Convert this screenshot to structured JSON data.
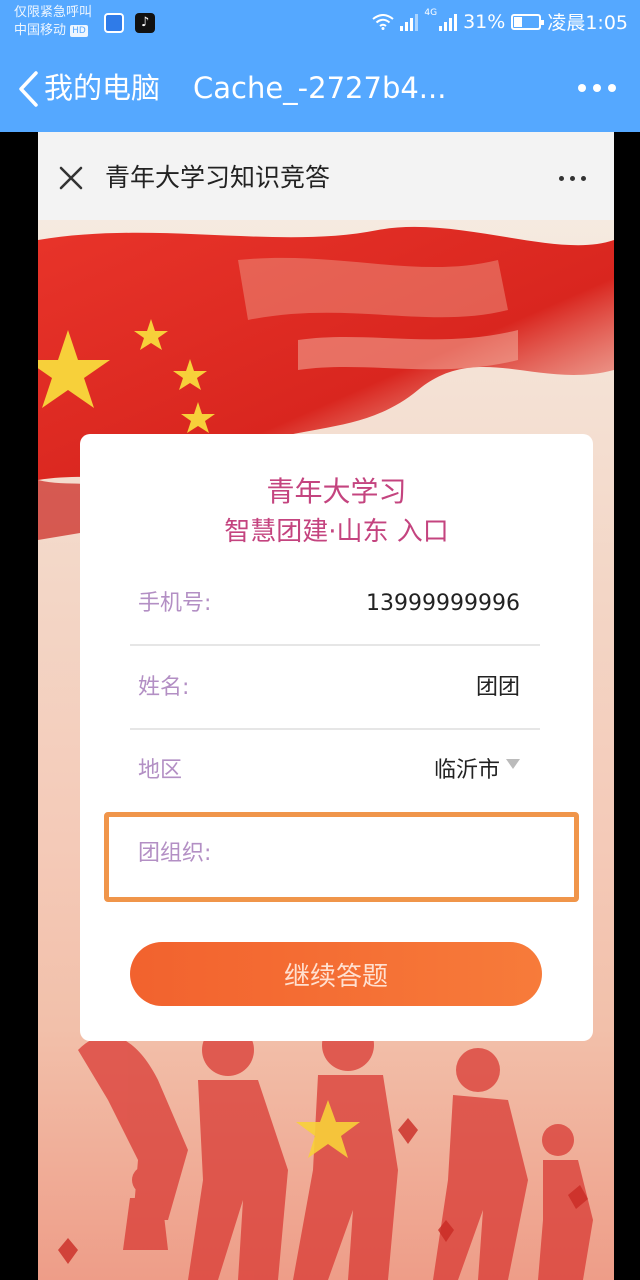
{
  "status_bar": {
    "emergency": "仅限紧急呼叫",
    "carrier": "中国移动",
    "carrier_badge": "HD",
    "network": "4G",
    "battery": "31%",
    "battery_level": 0.31,
    "time": "凌晨1:05"
  },
  "nav": {
    "back_label": "我的电脑",
    "title": "Cache_-2727b4..."
  },
  "webview": {
    "title": "青年大学习知识竞答"
  },
  "form": {
    "title_line1": "青年大学习",
    "title_line2": "智慧团建·山东 入口",
    "phone_label": "手机号:",
    "phone_value": "13999999996",
    "name_label": "姓名:",
    "name_value": "团团",
    "region_label": "地区",
    "region_value": "临沂市",
    "org_label": "团组织:",
    "org_value": "",
    "submit_label": "继续答题"
  },
  "colors": {
    "topbar": "#55a8ff",
    "accent": "#f2622e",
    "title_pink": "#c4447f",
    "highlight": "#f0954a",
    "label_purple": "#b38fc4"
  }
}
